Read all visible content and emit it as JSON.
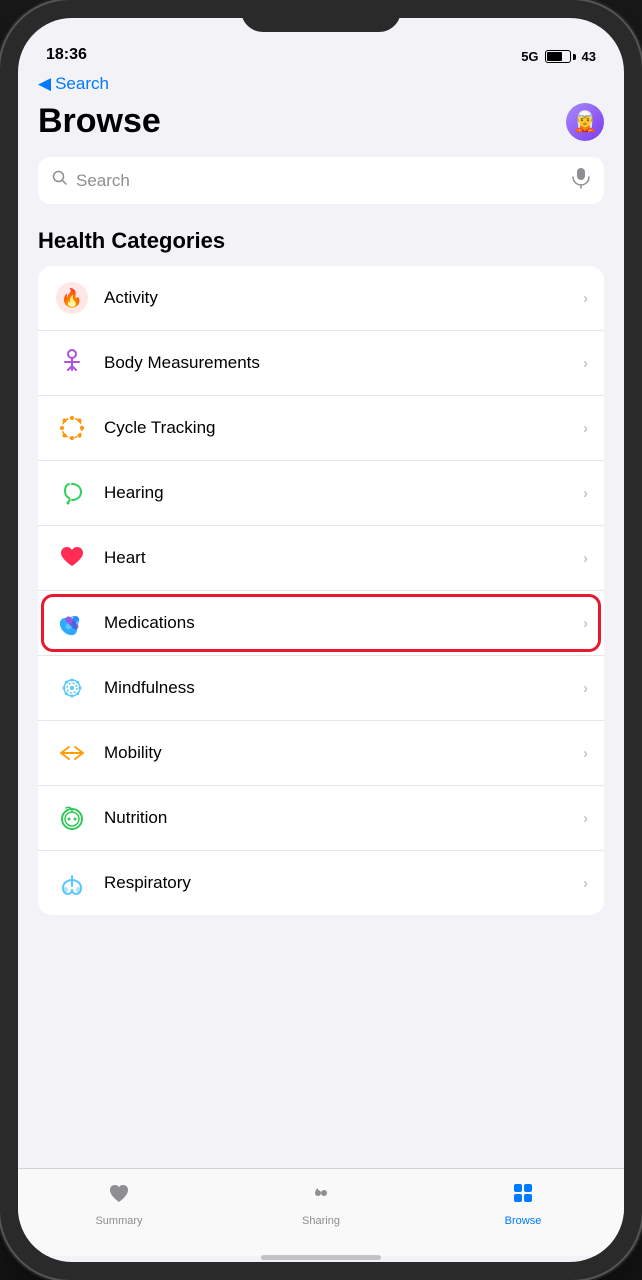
{
  "status": {
    "time": "18:36",
    "carrier": "5G",
    "battery": "43"
  },
  "nav": {
    "back_label": "Search"
  },
  "page": {
    "title": "Browse",
    "avatar_emoji": "🧝"
  },
  "search": {
    "placeholder": "Search"
  },
  "categories_header": "Health Categories",
  "categories": [
    {
      "id": "activity",
      "label": "Activity",
      "highlighted": false
    },
    {
      "id": "body",
      "label": "Body Measurements",
      "highlighted": false
    },
    {
      "id": "cycle",
      "label": "Cycle Tracking",
      "highlighted": false
    },
    {
      "id": "hearing",
      "label": "Hearing",
      "highlighted": false
    },
    {
      "id": "heart",
      "label": "Heart",
      "highlighted": false
    },
    {
      "id": "medications",
      "label": "Medications",
      "highlighted": true
    },
    {
      "id": "mindfulness",
      "label": "Mindfulness",
      "highlighted": false
    },
    {
      "id": "mobility",
      "label": "Mobility",
      "highlighted": false
    },
    {
      "id": "nutrition",
      "label": "Nutrition",
      "highlighted": false
    },
    {
      "id": "respiratory",
      "label": "Respiratory",
      "highlighted": false
    }
  ],
  "tabs": [
    {
      "id": "summary",
      "label": "Summary",
      "active": false
    },
    {
      "id": "sharing",
      "label": "Sharing",
      "active": false
    },
    {
      "id": "browse",
      "label": "Browse",
      "active": true
    }
  ],
  "chevron": "›"
}
